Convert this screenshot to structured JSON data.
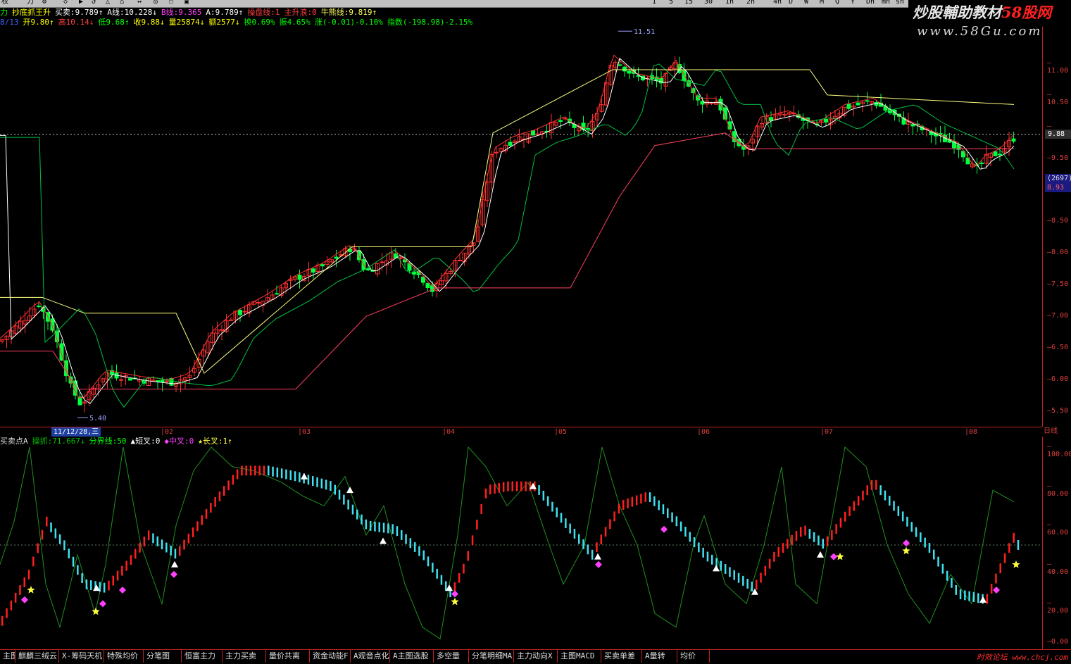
{
  "toolbar": {
    "items": [
      "权",
      "力",
      "⚙",
      "◇",
      "▶",
      "↺",
      "△",
      "⌂",
      "↔",
      "◎",
      "☐",
      "▣",
      "1",
      "5",
      "15",
      "30",
      "1h",
      "2h",
      "4h",
      "D",
      "W",
      "M",
      "Q",
      "Y",
      "Dh",
      "mn",
      "sh"
    ]
  },
  "watermark": {
    "line1_a": "炒股輔助教材",
    "line1_b": "58股网",
    "line2": "www.58Gu.com"
  },
  "header1": {
    "indicator_name": "抄底抓王升",
    "fields": [
      {
        "text": "力",
        "color": "#00ff00"
      },
      {
        "text": "抄底抓王升",
        "color": "#ffff00"
      },
      {
        "text": "买卖:9.789↑",
        "color": "#ffffff"
      },
      {
        "text": "A线:10.228↓",
        "color": "#ffffff"
      },
      {
        "text": "B线:9.365",
        "color": "#ff40ff"
      },
      {
        "text": "A:9.789↑",
        "color": "#ffffff"
      },
      {
        "text": "操盘线:1",
        "color": "#ff4040"
      },
      {
        "text": "主升浪:0",
        "color": "#ff4040"
      },
      {
        "text": "牛熊线:9.819↑",
        "color": "#ffff60"
      }
    ]
  },
  "header2": {
    "fields": [
      {
        "text": "8/13",
        "color": "#4060ff"
      },
      {
        "text": "开9.80↑",
        "color": "#ffff00"
      },
      {
        "text": "高10.14↓",
        "color": "#ff4040"
      },
      {
        "text": "低9.68↑",
        "color": "#00ff00"
      },
      {
        "text": "收9.88↓",
        "color": "#ffff00"
      },
      {
        "text": "量25874↓",
        "color": "#ffff00"
      },
      {
        "text": "额2577↓",
        "color": "#ffff00"
      },
      {
        "text": "换0.69%",
        "color": "#00ff00"
      },
      {
        "text": "振4.65%",
        "color": "#00ff00"
      },
      {
        "text": "涨(-0.01)-0.10%",
        "color": "#00ff00"
      },
      {
        "text": "指数(-198.98)-2.15%",
        "color": "#00ff00"
      }
    ]
  },
  "price_axis": {
    "labels": [
      "11.00",
      "10.50",
      "10.00",
      "9.50",
      "9.00",
      "8.50",
      "8.00",
      "7.50",
      "7.00",
      "6.50",
      "6.00",
      "5.50"
    ],
    "current_price": "9.88",
    "vol_tag_1": "(2697)",
    "vol_tag_2": "8.93"
  },
  "price_chart": {
    "high_label": "11.51",
    "low_label": "5.40",
    "colors": {
      "up": "#ff3030",
      "down": "#00ff40",
      "ma_white": "#ffffff",
      "ma_yellow": "#ffff80",
      "ma_green": "#00c040",
      "ma_red": "#ff4060"
    }
  },
  "date_bar": {
    "current": "11/12/28,三",
    "months": [
      "02",
      "03",
      "04",
      "05",
      "06",
      "07",
      "08"
    ],
    "day_button": "日线"
  },
  "indicator_header": {
    "fields": [
      {
        "text": "买卖点A",
        "color": "#dddddd"
      },
      {
        "text": "操抓:71.667↓",
        "color": "#00c000"
      },
      {
        "text": "分界线:50",
        "color": "#00ff00"
      },
      {
        "text": "▲短叉:0",
        "color": "#ffffff"
      },
      {
        "text": "◆中叉:0",
        "color": "#ff40ff"
      },
      {
        "text": "★长叉:1↑",
        "color": "#ffff40"
      }
    ]
  },
  "indicator_axis": {
    "labels": [
      "100.00",
      "80.00",
      "60.00",
      "40.00",
      "20.00",
      "0.00"
    ]
  },
  "tabs": {
    "items": [
      "主图",
      "麒麟三绒云",
      "X-筹码天机",
      "特殊均价",
      "分笔图",
      "恒富主力",
      "主力买卖",
      "量价共离",
      "资金动能F",
      "A观音点化",
      "A主图选股",
      "多空量",
      "分笔明细MA",
      "主力动向X",
      "主图MACD",
      "买卖单差",
      "A量转",
      "均价"
    ],
    "brand": "时效论坛 www.chcj.com"
  }
}
